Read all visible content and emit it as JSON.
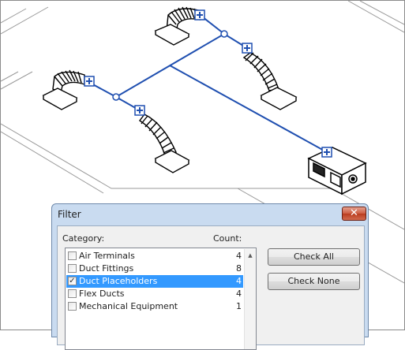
{
  "dialog": {
    "title": "Filter",
    "close_glyph": "✕",
    "category_label": "Category:",
    "count_label": "Count:",
    "items": [
      {
        "name": "Air Terminals",
        "count": "4",
        "checked": false,
        "selected": false
      },
      {
        "name": "Duct Fittings",
        "count": "8",
        "checked": false,
        "selected": false
      },
      {
        "name": "Duct Placeholders",
        "count": "4",
        "checked": true,
        "selected": true
      },
      {
        "name": "Flex Ducts",
        "count": "4",
        "checked": false,
        "selected": false
      },
      {
        "name": "Mechanical Equipment",
        "count": "1",
        "checked": false,
        "selected": false
      }
    ],
    "check_all_label": "Check All",
    "check_none_label": "Check None",
    "check_glyph": "✓",
    "scroll_up_glyph": "▲"
  },
  "colors": {
    "duct_line": "#1f4fb0",
    "selection": "#3399ff",
    "title_bar": "#c9dbf0",
    "close_button": "#c9452a"
  }
}
